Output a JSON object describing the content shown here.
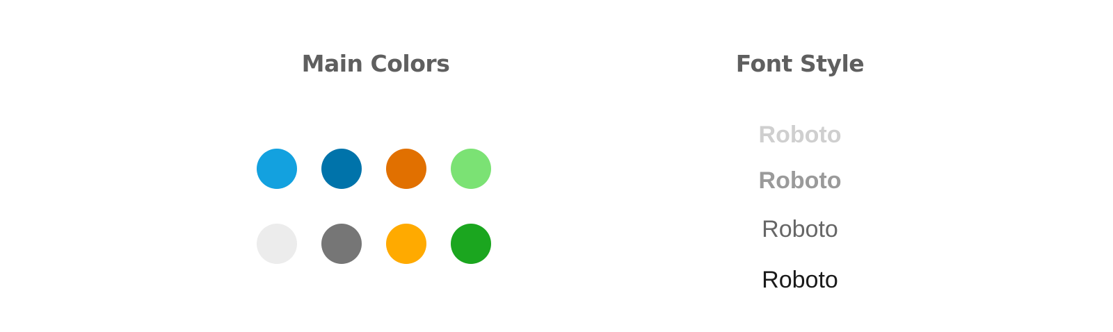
{
  "main_colors": {
    "title": "Main Colors",
    "swatches": [
      {
        "name": "light-blue",
        "color": "#13a1df"
      },
      {
        "name": "dark-blue",
        "color": "#0073aa"
      },
      {
        "name": "orange",
        "color": "#e17000"
      },
      {
        "name": "light-green",
        "color": "#7be274"
      },
      {
        "name": "light-gray",
        "color": "#ececec"
      },
      {
        "name": "gray",
        "color": "#767676"
      },
      {
        "name": "amber",
        "color": "#ffaa00"
      },
      {
        "name": "green",
        "color": "#1ba61f"
      }
    ]
  },
  "font_style": {
    "title": "Font Style",
    "samples": [
      {
        "text": "Roboto",
        "color": "#cfcfcf",
        "weight": "bold"
      },
      {
        "text": "Roboto",
        "color": "#9a9a9a",
        "weight": "bold"
      },
      {
        "text": "Roboto",
        "color": "#666666",
        "weight": "regular"
      },
      {
        "text": "Roboto",
        "color": "#1a1a1a",
        "weight": "light"
      }
    ]
  }
}
